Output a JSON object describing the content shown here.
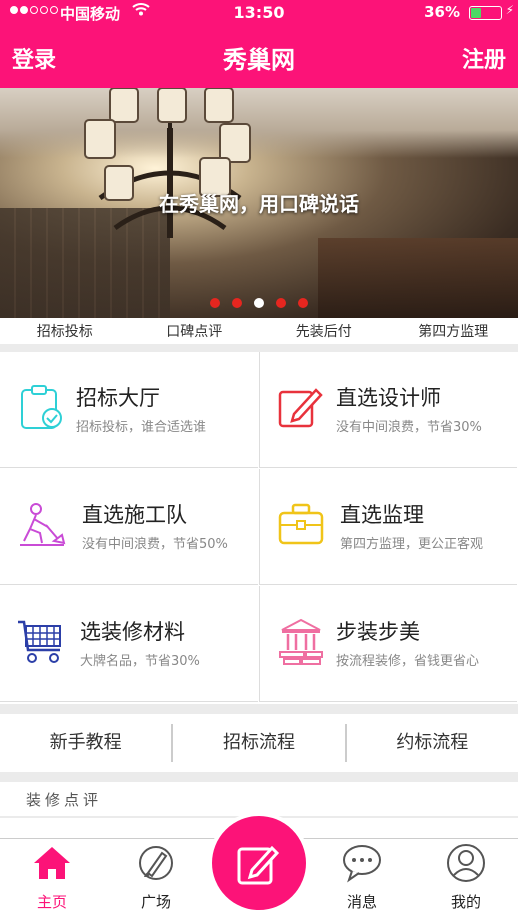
{
  "status_bar": {
    "carrier": "中国移动",
    "time": "13:50",
    "battery": "36%",
    "battery_level": 0.36
  },
  "header": {
    "login": "登录",
    "title": "秀巢网",
    "register": "注册"
  },
  "banner": {
    "slogan": "在秀巢网，用口碑说话",
    "slide_count": 5,
    "active_slide": 3
  },
  "features": [
    "招标投标",
    "口碑点评",
    "先装后付",
    "第四方监理"
  ],
  "grid": [
    {
      "title": "招标大厅",
      "subtitle": "招标投标，谁合适选谁",
      "icon": "clipboard-check-icon"
    },
    {
      "title": "直选设计师",
      "subtitle": "没有中间浪费，节省30%",
      "icon": "edit-pen-icon"
    },
    {
      "title": "直选施工队",
      "subtitle": "没有中间浪费，节省50%",
      "icon": "worker-shovel-icon"
    },
    {
      "title": "直选监理",
      "subtitle": "第四方监理，更公正客观",
      "icon": "briefcase-icon"
    },
    {
      "title": "选装修材料",
      "subtitle": "大牌名品，节省30%",
      "icon": "shopping-cart-icon"
    },
    {
      "title": "步装步美",
      "subtitle": "按流程装修，省钱更省心",
      "icon": "building-steps-icon"
    }
  ],
  "process": [
    "新手教程",
    "招标流程",
    "约标流程"
  ],
  "reviews": {
    "label": "装修点评"
  },
  "tabbar": [
    {
      "label": "主页",
      "icon": "home-icon",
      "active": true
    },
    {
      "label": "广场",
      "icon": "brush-icon",
      "active": false
    },
    {
      "label": "消息",
      "icon": "chat-bubble-icon",
      "active": false
    },
    {
      "label": "我的",
      "icon": "user-icon",
      "active": false
    }
  ],
  "colors": {
    "brand": "#fc1378",
    "cyan": "#2ed0d6",
    "red": "#e8323c",
    "purple": "#c94bd6",
    "yellow": "#f0c419",
    "blue": "#2c3fa8",
    "pink": "#ef6fa1"
  }
}
